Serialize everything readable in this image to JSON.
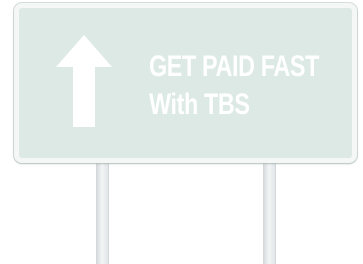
{
  "sign": {
    "line1": "GET PAID FAST",
    "line2": "With TBS",
    "icon": "arrow-up-icon",
    "colors": {
      "panel": "#dce9e4",
      "text": "#ffffff",
      "border": "#f5f7f6",
      "posts": "#e6eaec"
    }
  }
}
